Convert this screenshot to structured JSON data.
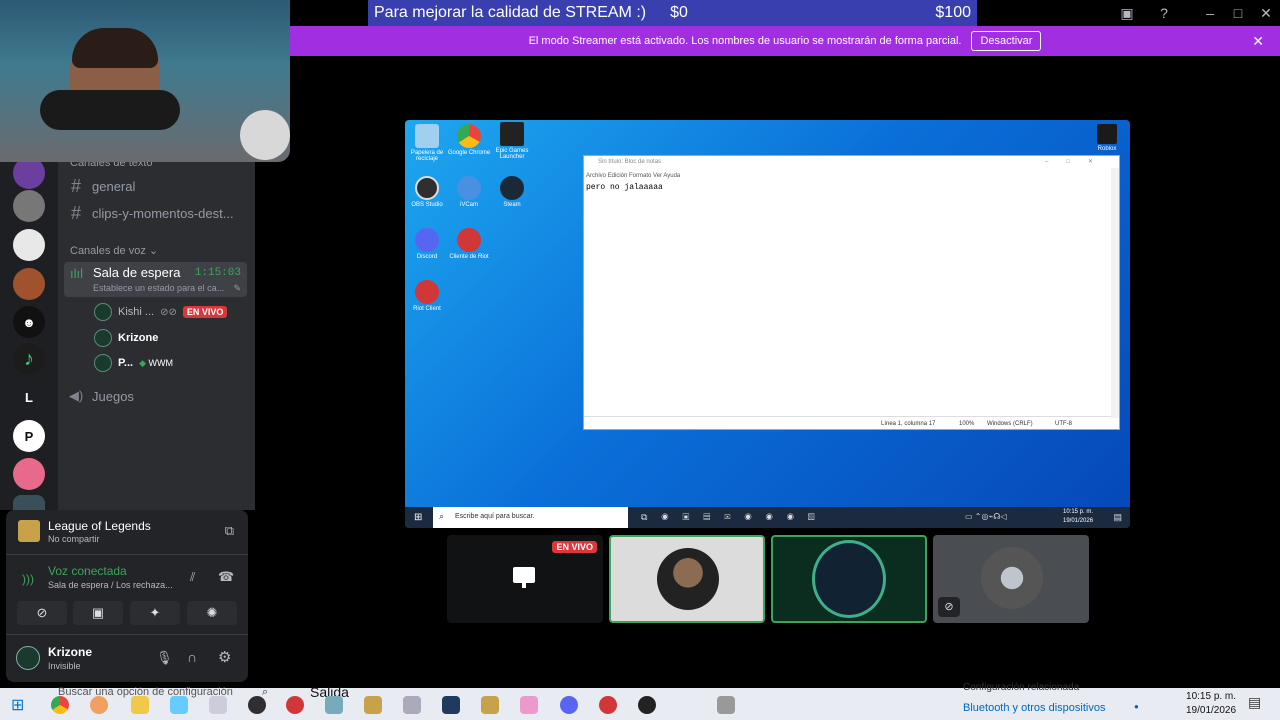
{
  "banner": {
    "text": "Para mejorar la calidad de STREAM :)",
    "amount_now": "$0",
    "amount_goal": "$100"
  },
  "streamer_mode": {
    "message": "El modo Streamer está activado. Los nombres de usuario se mostrarán de forma parcial.",
    "button": "Desactivar",
    "close": "✕"
  },
  "channels": {
    "text_section": "Canales de texto",
    "text_items": [
      {
        "label": "general"
      },
      {
        "label": "clips-y-momentos-dest..."
      }
    ],
    "voice_section": "Canales de voz",
    "voice_channel": {
      "name": "Sala de espera",
      "timer": "1:15:03",
      "status": "Establece un estado para el ca..."
    },
    "voice_users": [
      {
        "name": "Kishi ...",
        "badge": "EN VIVO"
      },
      {
        "name": "Krizone"
      },
      {
        "name": "P...",
        "tag": "WWM"
      }
    ],
    "other_voice": "Juegos"
  },
  "activity": {
    "game": "League of Legends",
    "sub": "No compartir"
  },
  "voice_connected": {
    "title": "Voz conectada",
    "sub": "Sala de espera / Los rechaza..."
  },
  "user": {
    "name": "Krizone",
    "status": "Invisible"
  },
  "rail_letter": "L",
  "stream": {
    "desktop_icons": [
      {
        "label": "Papelera de reciclaje",
        "color": "#9fd0f0"
      },
      {
        "label": "Google Chrome",
        "color": "#e8453c"
      },
      {
        "label": "Epic Games Launcher",
        "color": "#222222"
      },
      {
        "label": "OBS Studio",
        "color": "#302e31"
      },
      {
        "label": "iVCam",
        "color": "#4a90e2"
      },
      {
        "label": "Steam",
        "color": "#1b2838"
      },
      {
        "label": "Discord",
        "color": "#5865f2"
      },
      {
        "label": "Cliente de Riot",
        "color": "#d13639"
      },
      {
        "label": "Riot Client",
        "color": "#d13639"
      },
      {
        "label": "Roblox",
        "color": "#1a1a1a"
      }
    ],
    "notepad": {
      "title": "Sin título: Bloc de notas",
      "menu": "Archivo  Edición  Formato  Ver  Ayuda",
      "content": "pero no jalaaaaa",
      "status_pos": "Línea 1, columna 17",
      "status_zoom": "100%",
      "status_eol": "Windows (CRLF)",
      "status_enc": "UTF-8"
    },
    "search": "Escribe aquí para buscar.",
    "clock_time": "10:15 p. m.",
    "clock_date": "19/01/2026"
  },
  "thumb_badge": "EN VIVO",
  "taskbar": {
    "search": "Buscar una opción de configuración",
    "salida": "Salida",
    "config": "Configuración relacionada",
    "bt": "Bluetooth y otros dispositivos",
    "time": "10:15 p. m.",
    "date": "19/01/2026"
  }
}
